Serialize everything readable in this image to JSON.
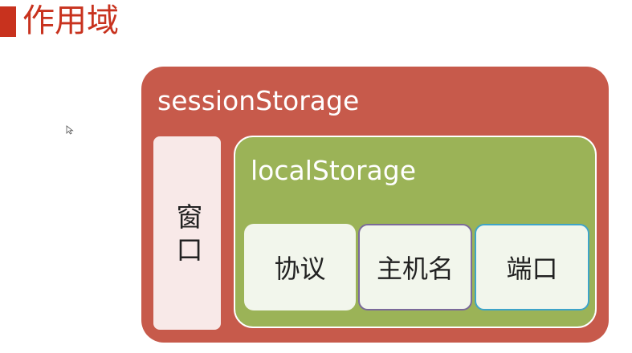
{
  "slide": {
    "title": "作用域"
  },
  "diagram": {
    "outer": {
      "label": "sessionStorage"
    },
    "window": {
      "label": "窗口"
    },
    "inner": {
      "label": "localStorage"
    },
    "cells": [
      {
        "label": "协议"
      },
      {
        "label": "主机名"
      },
      {
        "label": "端口"
      }
    ]
  },
  "colors": {
    "accent": "#c8321e",
    "session_fill": "#c75a4b",
    "local_fill": "#9bb357",
    "window_fill": "#f8e9e8",
    "cell_fill": "#f2f6ec",
    "host_border": "#7b6a9a",
    "port_border": "#3ea4c9"
  },
  "icons": {
    "cursor": "mouse-pointer-icon"
  }
}
